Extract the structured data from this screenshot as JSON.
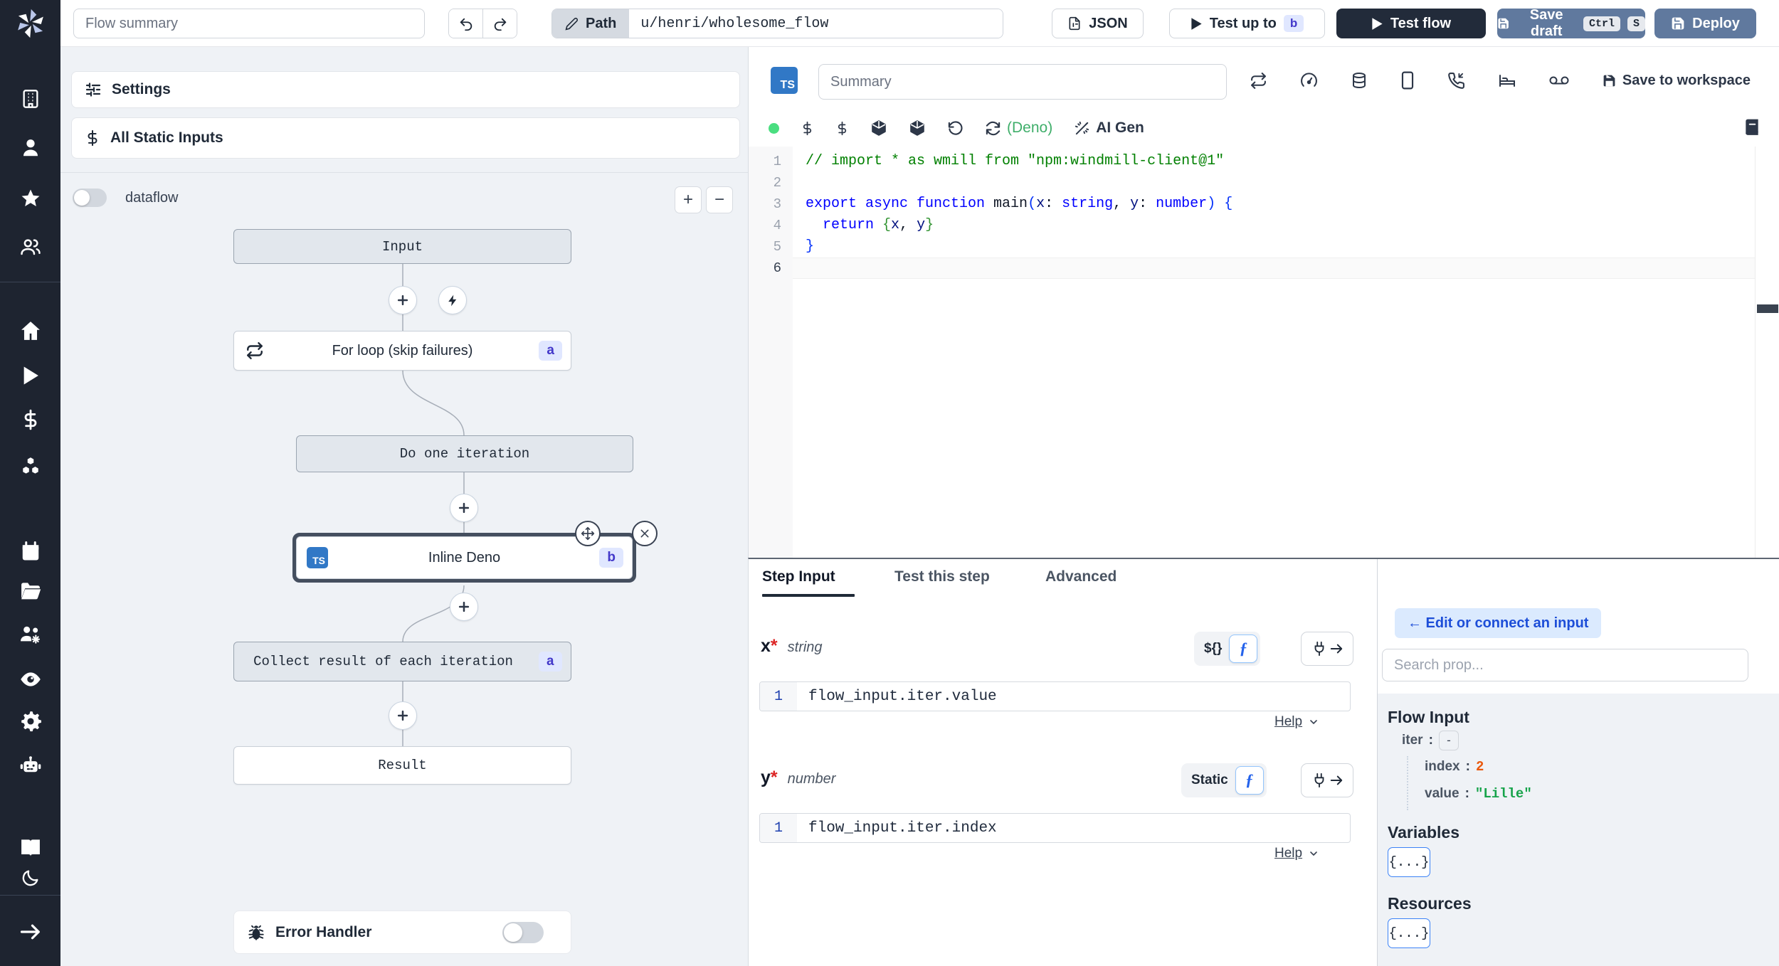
{
  "colors": {
    "sidebar_bg": "#1e2430",
    "accent_slate_button": "#60799e",
    "dark_button": "#222b3a",
    "badge_bg": "#e0e7ff",
    "badge_text": "#4338ca",
    "ts_blue": "#3178c6",
    "connect_bg": "#dbeafe",
    "connect_text": "#1d4ed8",
    "deno_green": "#3fae6a",
    "num_orange": "#ea580c",
    "str_green": "#16a34a",
    "comment_green": "#008000",
    "keyword_blue": "#0000ff"
  },
  "topbar": {
    "flow_summary_placeholder": "Flow summary",
    "path_label": "Path",
    "path_value": "u/henri/wholesome_flow",
    "json_label": "JSON",
    "test_up_to_label": "Test up to",
    "test_up_to_badge": "b",
    "test_flow_label": "Test flow",
    "save_draft_label": "Save draft",
    "save_draft_kbd_1": "Ctrl",
    "save_draft_kbd_2": "S",
    "deploy_label": "Deploy"
  },
  "flow_panel": {
    "settings_label": "Settings",
    "static_inputs_label": "All Static Inputs",
    "dataflow_label": "dataflow",
    "zoom_in": "+",
    "zoom_out": "−",
    "nodes": {
      "input": "Input",
      "for_loop": "For loop (skip failures)",
      "for_loop_badge": "a",
      "iteration": "Do one iteration",
      "inline_lang": "TS",
      "inline": "Inline Deno",
      "inline_badge": "b",
      "collect": "Collect result of each iteration",
      "collect_badge": "a",
      "result": "Result"
    },
    "error_handler_label": "Error Handler"
  },
  "editor": {
    "lang_badge": "TS",
    "summary_placeholder": "Summary",
    "save_to_workspace_label": "Save to workspace",
    "deno_label": "(Deno)",
    "ai_gen_label": "AI Gen",
    "code": {
      "ln1": "1",
      "ln2": "2",
      "ln3": "3",
      "ln4": "4",
      "ln5": "5",
      "ln6": "6",
      "l1": "// import * as wmill from \"npm:windmill-client@1\"",
      "l3": {
        "t0": "export async function",
        "t1": " main",
        "t2": "(",
        "t3": "x",
        "t4": ": ",
        "t5": "string",
        "t6": ", ",
        "t7": "y",
        "t8": ": ",
        "t9": "number",
        "t10": ")",
        "t11": " {"
      },
      "l4": {
        "t0": "  return ",
        "t1": "{",
        "t2": "x",
        "t3": ", ",
        "t4": "y",
        "t5": "}"
      },
      "l5": "}"
    }
  },
  "step_panel": {
    "tabs": {
      "step_input": "Step Input",
      "test_this_step": "Test this step",
      "advanced": "Advanced"
    },
    "x": {
      "name": "x",
      "required": "*",
      "type": "string",
      "toggle_label": "${}",
      "fn_label": "ƒ",
      "line_no": "1",
      "expr": "flow_input.iter.value",
      "help": "Help"
    },
    "y": {
      "name": "y",
      "required": "*",
      "type": "number",
      "toggle_label": "Static",
      "fn_label": "ƒ",
      "line_no": "1",
      "expr": "flow_input.iter.index",
      "help": "Help"
    }
  },
  "right_panel": {
    "connect_label": "← Edit or connect an input",
    "search_placeholder": "Search prop...",
    "flow_input_title": "Flow Input",
    "iter_key": "iter",
    "iter_collapse": "-",
    "index_key": "index",
    "index_value": "2",
    "value_key": "value",
    "value_value": "\"Lille\"",
    "variables_title": "Variables",
    "variables_value": "{...}",
    "resources_title": "Resources",
    "resources_value": "{...}"
  }
}
